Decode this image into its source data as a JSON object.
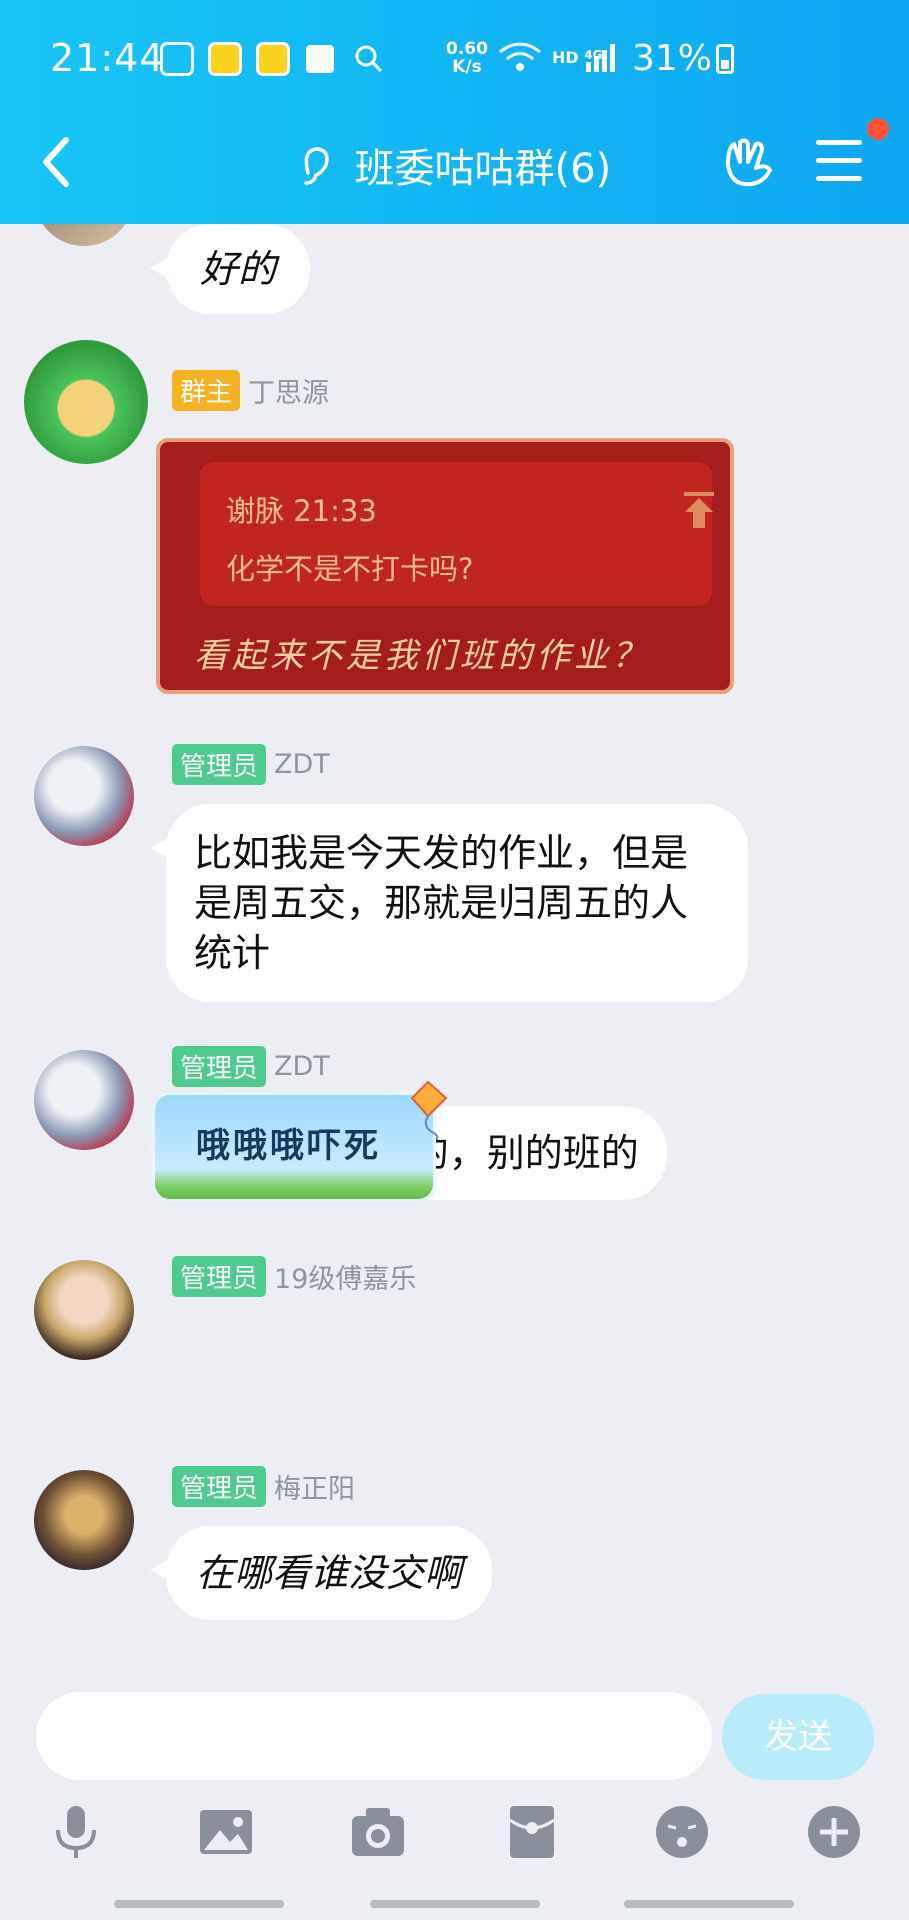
{
  "status_bar": {
    "time": "21:44",
    "net_speed_value": "0.60",
    "net_speed_unit": "K/s",
    "network": "HD",
    "network_type": "4G",
    "battery": "31%"
  },
  "header": {
    "title": "班委咕咕群(6)",
    "accent_color": "#12b6f3",
    "notification_dot_color": "#ff5138"
  },
  "messages": [
    {
      "text": "好的"
    },
    {
      "role": "群主",
      "sender": "丁思源",
      "reply_ref": "谢脉 21:33",
      "reply_quote": "化学不是不打卡吗?",
      "text": "看起来不是我们班的作业？"
    },
    {
      "role": "管理员",
      "sender": "ZDT",
      "lines": [
        "比如我是今天发的作业，但是",
        "是周五交，那就是归周五的人",
        "统计"
      ]
    },
    {
      "role": "管理员",
      "sender": "ZDT",
      "text": "@Siyuan 是的，别的班的"
    },
    {
      "role": "管理员",
      "sender": "19级傅嘉乐",
      "text": "哦哦哦吓死"
    },
    {
      "role": "管理员",
      "sender": "梅正阳",
      "text": "在哪看谁没交啊"
    }
  ],
  "input": {
    "placeholder": "",
    "send_label": "发送"
  },
  "toolbar": [
    "microphone-icon",
    "image-icon",
    "camera-icon",
    "red-packet-icon",
    "emoji-icon",
    "plus-icon"
  ]
}
